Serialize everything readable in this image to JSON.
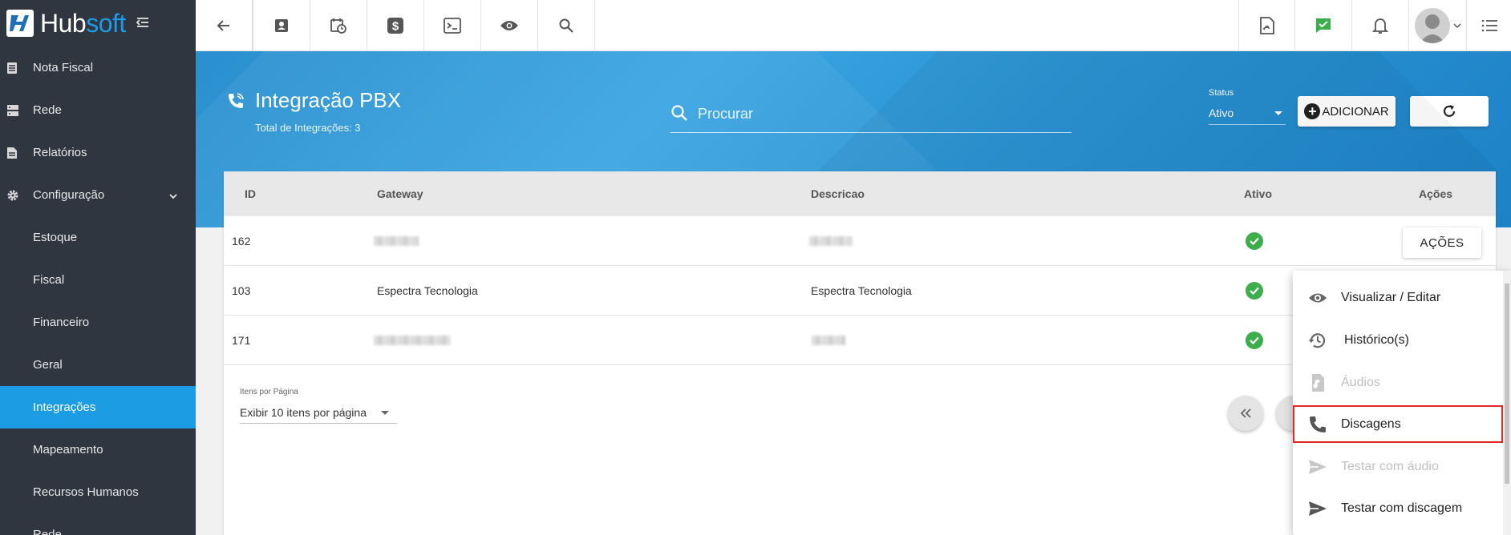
{
  "brand": {
    "hub": "Hub",
    "soft": "soft"
  },
  "sidebar": {
    "items": [
      {
        "label": "Nota Fiscal",
        "icon": "document-icon"
      },
      {
        "label": "Rede",
        "icon": "server-icon"
      },
      {
        "label": "Relatórios",
        "icon": "report-icon"
      },
      {
        "label": "Configuração",
        "icon": "gear-icon"
      },
      {
        "label": "Estoque"
      },
      {
        "label": "Fiscal"
      },
      {
        "label": "Financeiro"
      },
      {
        "label": "Geral"
      },
      {
        "label": "Integrações",
        "active": true
      },
      {
        "label": "Mapeamento"
      },
      {
        "label": "Recursos Humanos"
      },
      {
        "label": "Rede"
      }
    ]
  },
  "header": {
    "title": "Integração PBX",
    "subtitle": "Total de Integrações: 3",
    "search_placeholder": "Procurar",
    "status_label": "Status",
    "status_value": "Ativo",
    "add_label": "ADICIONAR"
  },
  "table": {
    "columns": [
      "ID",
      "Gateway",
      "Descricao",
      "Ativo",
      "Ações"
    ],
    "rows": [
      {
        "id": "162",
        "gateway": "",
        "descricao": "",
        "ativo": true
      },
      {
        "id": "103",
        "gateway": "Espectra Tecnologia",
        "descricao": "Espectra Tecnologia",
        "ativo": true
      },
      {
        "id": "171",
        "gateway": "",
        "descricao": "",
        "ativo": true
      }
    ],
    "actions_button": "AÇÕES"
  },
  "pagination": {
    "label": "Itens por Página",
    "selected": "Exibir 10 itens por página"
  },
  "actions_menu": {
    "items": [
      {
        "label": "Visualizar / Editar",
        "icon": "eye-icon",
        "disabled": false
      },
      {
        "label": "Histórico(s)",
        "icon": "history-icon",
        "disabled": false
      },
      {
        "label": "Áudios",
        "icon": "audio-file-icon",
        "disabled": true
      },
      {
        "label": "Discagens",
        "icon": "phone-icon",
        "disabled": false,
        "highlighted": true
      },
      {
        "label": "Testar com áudio",
        "icon": "send-icon",
        "disabled": true
      },
      {
        "label": "Testar com discagem",
        "icon": "send-icon",
        "disabled": false
      }
    ]
  },
  "colors": {
    "sidebar_bg": "#2f3640",
    "accent": "#1b9ce3",
    "success": "#3cae4b",
    "highlight_border": "#e42727"
  }
}
